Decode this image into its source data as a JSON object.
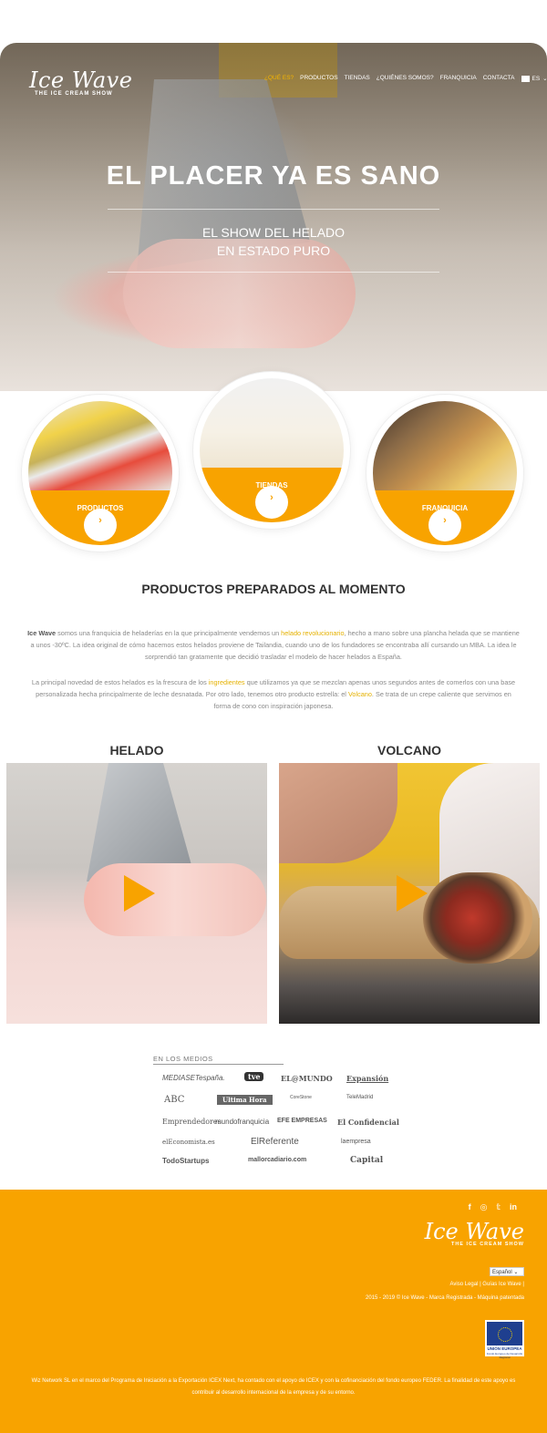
{
  "header": {
    "logo_brand": "Ice Wave",
    "logo_tagline": "THE ICE CREAM SHOW",
    "nav": [
      "¿QUÉ ES?",
      "PRODUCTOS",
      "TIENDAS",
      "¿QUIÉNES SOMOS?",
      "FRANQUICIA",
      "CONTACTA"
    ],
    "lang": "ES",
    "lang_chevron": "⌄"
  },
  "hero": {
    "title": "EL PLACER YA ES SANO",
    "subtitle_line1": "EL SHOW DEL HELADO",
    "subtitle_line2": "EN ESTADO PURO"
  },
  "cards": [
    {
      "label": "PRODUCTOS",
      "icon": "chevron-right-icon"
    },
    {
      "label": "TIENDAS",
      "icon": "chevron-right-icon"
    },
    {
      "label": "FRANQUICIA",
      "icon": "chevron-right-icon"
    }
  ],
  "arrow_glyph": "›",
  "intro": {
    "title": "PRODUCTOS PREPARADOS AL MOMENTO",
    "p1_brand": "Ice Wave",
    "p1_a": " somos una franquicia de heladerías en la que principalmente vendemos un ",
    "p1_link": "helado revolucionario",
    "p1_b": ", hecho a mano sobre una plancha helada que se mantiene a unos -30ºC. La idea original de cómo hacemos estos helados proviene de Tailandia, cuando uno de los fundadores se encontraba allí cursando un MBA. La idea le sorprendió tan gratamente que decidió trasladar el modelo de hacer helados a España.",
    "p2_a": "La principal novedad de estos helados es la frescura de los ",
    "p2_link1": "ingredientes",
    "p2_b": " que utilizamos ya que se mezclan apenas unos segundos antes de comerlos con una base personalizada hecha principalmente de leche desnatada. Por otro lado, tenemos otro producto estrella: el ",
    "p2_link2": "Volcano",
    "p2_c": ". Se trata de un crepe caliente que servimos en forma de cono con inspiración japonesa."
  },
  "videos": [
    {
      "title": "HELADO"
    },
    {
      "title": "VOLCANO"
    }
  ],
  "media": {
    "title": "EN LOS MEDIOS",
    "logos": [
      "MEDIASETespaña.",
      "tve",
      "EL@MUNDO",
      "Expansión",
      "ABC",
      "Ultima Hora",
      "CoreStone",
      "TeleMadrid",
      "Emprendedores",
      "mundofranquicia",
      "EFE EMPRESAS",
      "El Confidencial",
      "elEconomista.es",
      "ElReferente",
      "laempresa",
      "TodoStartups",
      "mallorcadiario.com",
      "Capital"
    ]
  },
  "footer": {
    "social": [
      "f",
      "◎",
      "𝕥",
      "in"
    ],
    "logo_brand": "Ice Wave",
    "logo_tagline": "THE ICE CREAM SHOW",
    "language_select": "Español",
    "links": "Aviso Legal | Guías Ice Wave |",
    "copyright": "2015 - 2019 © Ice Wave - Marca Registrada - Máquina patentada",
    "eu_label": "UNIÓN EUROPEA",
    "eu_sub": "Fondo Europeo de Desarrollo Regional",
    "note": "Wiz Network SL en el marco del Programa de Iniciación a la Exportación ICEX Next, ha contado con el apoyo de ICEX y con la cofinanciación del fondo europeo FEDER. La finalidad de este apoyo es contribuir al desarrollo internacional de la empresa y de su entorno."
  }
}
